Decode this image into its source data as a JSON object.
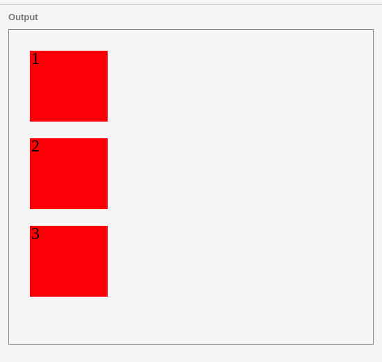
{
  "header": {
    "label": "Output"
  },
  "boxes": [
    {
      "label": "1"
    },
    {
      "label": "2"
    },
    {
      "label": "3"
    }
  ],
  "colors": {
    "box_bg": "#fb0007",
    "page_bg": "#f5f5f5",
    "border": "#888"
  }
}
